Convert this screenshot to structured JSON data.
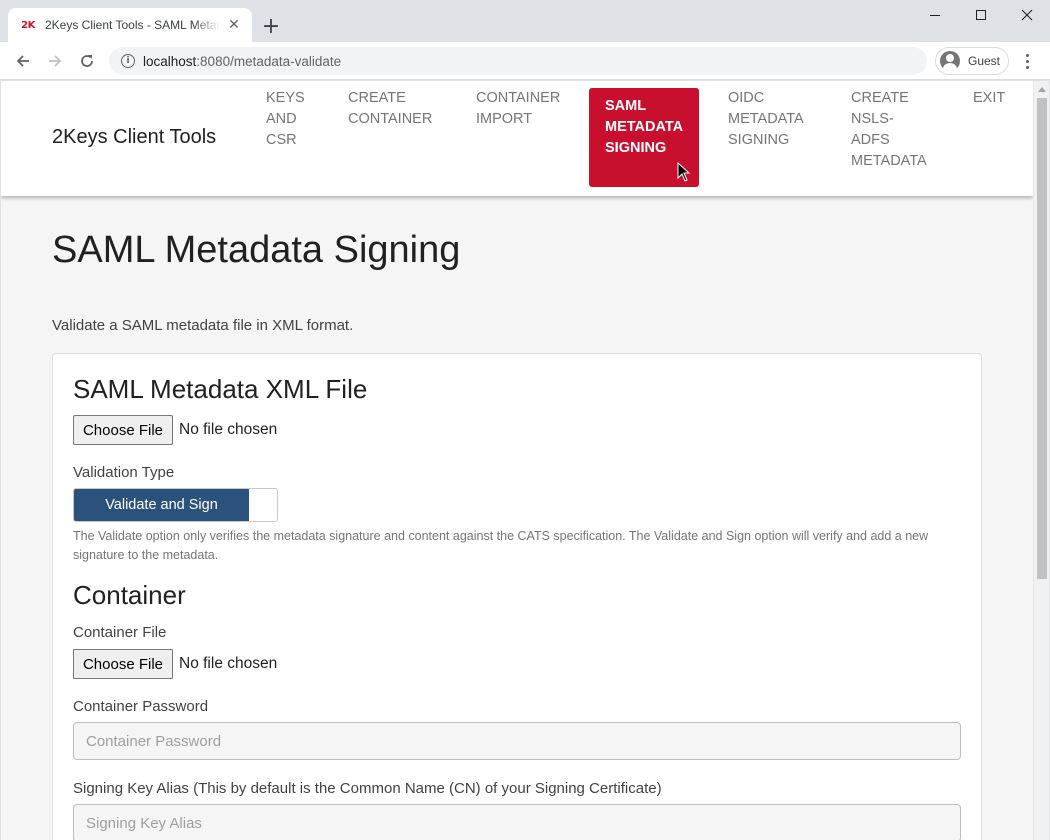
{
  "browser": {
    "tab_title": "2Keys Client Tools - SAML Metadata Signing",
    "tab_favicon_text": "2K",
    "new_tab_glyph": "+",
    "url_host": "localhost",
    "url_path": ":8080/metadata-validate",
    "profile_label": "Guest",
    "icons": [
      "back-arrow-icon",
      "forward-arrow-icon",
      "reload-icon",
      "info-icon",
      "profile-avatar-icon",
      "kebab-menu-icon",
      "minimize-icon",
      "maximize-icon",
      "close-icon"
    ]
  },
  "app": {
    "brand": "2Keys Client Tools",
    "nav": [
      {
        "lines": [
          "KEYS",
          "AND",
          "CSR"
        ],
        "active": false
      },
      {
        "lines": [
          "CREATE",
          "CONTAINER"
        ],
        "active": false
      },
      {
        "lines": [
          "CONTAINER",
          "IMPORT"
        ],
        "active": false
      },
      {
        "lines": [
          "SAML",
          "METADATA",
          "SIGNING"
        ],
        "active": true
      },
      {
        "lines": [
          "OIDC",
          "METADATA",
          "SIGNING"
        ],
        "active": false
      },
      {
        "lines": [
          "CREATE",
          "NSLS-",
          "ADFS",
          "METADATA"
        ],
        "active": false
      },
      {
        "lines": [
          "EXIT"
        ],
        "active": false
      }
    ],
    "active_color": "#c8102e"
  },
  "page": {
    "title": "SAML Metadata Signing",
    "subtitle": "Validate a SAML metadata file in XML format.",
    "xml_section": {
      "title": "SAML Metadata XML File",
      "choose_file_label": "Choose File",
      "file_status": "No file chosen"
    },
    "validation": {
      "label": "Validation Type",
      "selected_option": "Validate and Sign",
      "help_text": "The Validate option only verifies the metadata signature and content against the CATS specification. The Validate and Sign option will verify and add a new signature to the metadata.",
      "toggle_color": "#2a527a"
    },
    "container_section": {
      "title": "Container",
      "file_label": "Container File",
      "choose_file_label": "Choose File",
      "file_status": "No file chosen",
      "password_label": "Container Password",
      "password_placeholder": "Container Password",
      "alias_label": "Signing Key Alias (This by default is the Common Name (CN) of your Signing Certificate)",
      "alias_placeholder": "Signing Key Alias"
    }
  }
}
